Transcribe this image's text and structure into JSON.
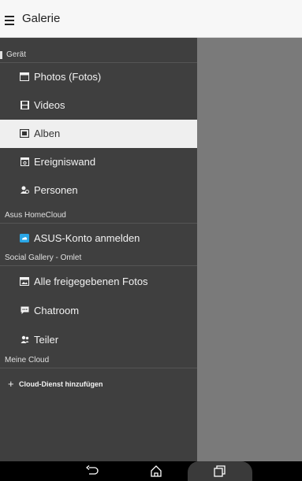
{
  "app": {
    "title": "Galerie"
  },
  "drawer": {
    "sections": {
      "device": "Gerät",
      "homecloud": "Asus HomeCloud",
      "social": "Social Gallery - Omlet",
      "mycloud": "Meine Cloud"
    },
    "device_items": [
      {
        "label": "Photos (Fotos)",
        "icon": "photos-icon"
      },
      {
        "label": "Videos",
        "icon": "film-icon"
      },
      {
        "label": "Alben",
        "icon": "album-icon",
        "selected": true
      },
      {
        "label": "Ereigniswand",
        "icon": "event-wall-icon"
      },
      {
        "label": "Personen",
        "icon": "people-icon"
      }
    ],
    "homecloud_items": [
      {
        "label": "ASUS-Konto anmelden",
        "icon": "asus-cloud-icon",
        "icon_color": "#2aa6e6"
      }
    ],
    "social_items": [
      {
        "label": "Alle freigegebenen Fotos",
        "icon": "shared-photos-icon"
      },
      {
        "label": "Chatroom",
        "icon": "chat-icon"
      },
      {
        "label": "Teiler",
        "icon": "sharer-icon"
      }
    ],
    "mycloud_items": [
      {
        "label": "Cloud-Dienst hinzufügen",
        "icon": "plus-icon"
      }
    ]
  },
  "navbar": {
    "buttons": [
      "back-icon",
      "home-icon",
      "recents-icon"
    ]
  },
  "colors": {
    "drawer_bg": "#3f3f3f",
    "selected_bg": "#efefef",
    "overlay": "#7a7a7a",
    "accent": "#2aa6e6"
  }
}
